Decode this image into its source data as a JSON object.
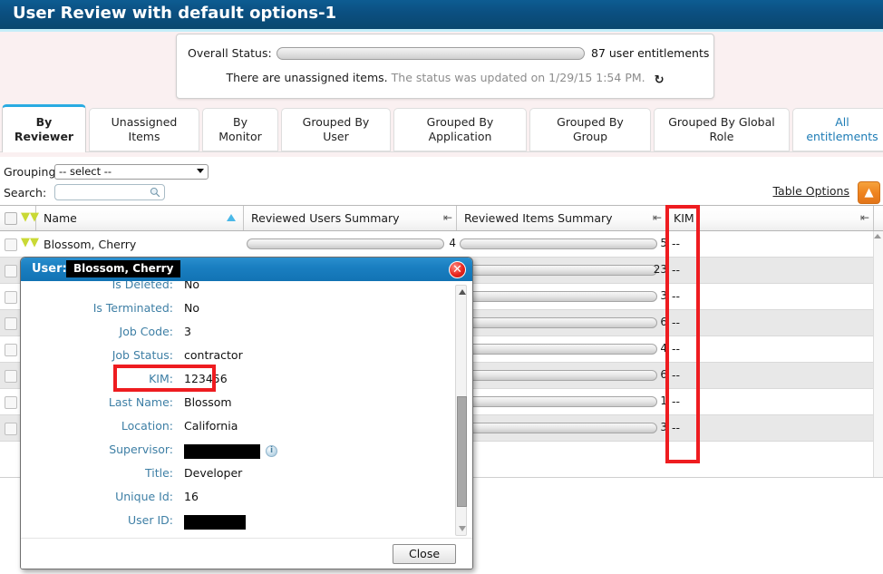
{
  "app": {
    "title": "User Review with default options-1"
  },
  "status": {
    "label": "Overall Status:",
    "count_text": "87 user entitlements",
    "message_dark": "There are unassigned items.",
    "message_grey": "The status was updated on 1/29/15 1:54 PM.",
    "refresh_icon": "refresh-icon",
    "progress_percent": 0
  },
  "tabs": [
    {
      "label": "By Reviewer",
      "line1": "By",
      "line2": "Reviewer",
      "active": true,
      "link": false
    },
    {
      "label": "Unassigned Items",
      "line1": "Unassigned",
      "line2": "Items",
      "active": false,
      "link": false
    },
    {
      "label": "By Monitor",
      "line1": "By",
      "line2": "Monitor",
      "active": false,
      "link": false
    },
    {
      "label": "Grouped By User",
      "line1": "Grouped By",
      "line2": "User",
      "active": false,
      "link": false
    },
    {
      "label": "Grouped By Application",
      "line1": "Grouped By",
      "line2": "Application",
      "active": false,
      "link": false
    },
    {
      "label": "Grouped By Group",
      "line1": "Grouped By",
      "line2": "Group",
      "active": false,
      "link": false
    },
    {
      "label": "Grouped By Global Role",
      "line1": "Grouped By Global",
      "line2": "Role",
      "active": false,
      "link": false
    },
    {
      "label": "All entitlements",
      "line1": "All",
      "line2": "entitlements",
      "active": false,
      "link": true
    }
  ],
  "controls": {
    "grouping_label": "Grouping:",
    "grouping_value": "-- select --",
    "search_label": "Search:",
    "search_value": "",
    "search_placeholder": "",
    "search_icon": "magnifier-icon",
    "table_options_label": "Table Options",
    "table_options_icon": "double-chevron-up-icon"
  },
  "table": {
    "columns": [
      {
        "key": "name",
        "label": "Name",
        "sorted": "asc"
      },
      {
        "key": "users",
        "label": "Reviewed Users Summary",
        "sorted": ""
      },
      {
        "key": "items",
        "label": "Reviewed Items Summary",
        "sorted": ""
      },
      {
        "key": "kim",
        "label": "KIM",
        "sorted": ""
      },
      {
        "key": "extra",
        "label": "",
        "sorted": ""
      }
    ],
    "rows": [
      {
        "name": "Blossom, Cherry",
        "users_value": "4",
        "items_value": "5",
        "kim": "--"
      },
      {
        "name": "",
        "users_value": "",
        "items_value": "23",
        "kim": "--"
      },
      {
        "name": "",
        "users_value": "",
        "items_value": "3",
        "kim": "--"
      },
      {
        "name": "",
        "users_value": "",
        "items_value": "6",
        "kim": "--"
      },
      {
        "name": "",
        "users_value": "",
        "items_value": "4",
        "kim": "--"
      },
      {
        "name": "",
        "users_value": "",
        "items_value": "6",
        "kim": "--"
      },
      {
        "name": "",
        "users_value": "",
        "items_value": "1",
        "kim": "--"
      },
      {
        "name": "",
        "users_value": "",
        "items_value": "3",
        "kim": "--"
      }
    ]
  },
  "dialog": {
    "title_label": "User:",
    "title_value": "Blossom, Cherry",
    "close_icon": "close-icon",
    "close_button": "Close",
    "info_icon": "info-icon",
    "fields": [
      {
        "label": "Is Deleted:",
        "value": "No",
        "redacted": false
      },
      {
        "label": "Is Terminated:",
        "value": "No",
        "redacted": false
      },
      {
        "label": "Job Code:",
        "value": "3",
        "redacted": false
      },
      {
        "label": "Job Status:",
        "value": "contractor",
        "redacted": false
      },
      {
        "label": "KIM:",
        "value": "123456",
        "redacted": false,
        "highlight": true
      },
      {
        "label": "Last Name:",
        "value": "Blossom",
        "redacted": false
      },
      {
        "label": "Location:",
        "value": "California",
        "redacted": false
      },
      {
        "label": "Supervisor:",
        "value": "",
        "redacted": true,
        "info": true
      },
      {
        "label": "Title:",
        "value": "Developer",
        "redacted": false
      },
      {
        "label": "Unique Id:",
        "value": "16",
        "redacted": false
      },
      {
        "label": "User ID:",
        "value": "",
        "redacted": true
      }
    ]
  },
  "annotations": {
    "kim_column_highlight": "red-rectangle-kim-column",
    "kim_field_highlight": "red-rectangle-kim-field"
  },
  "colors": {
    "header_blue": "#0b4f80",
    "header_underline": "#c5eef9",
    "status_bg": "#faf0f1",
    "tab_active_accent": "#29abe2",
    "link_blue": "#1c7bb5",
    "dialog_blue": "#1a7fc1",
    "annotation_red": "#ee1c20",
    "field_label_blue": "#3e7fa5",
    "options_orange": "#ef8420",
    "chevron_green": "#c9d935"
  }
}
